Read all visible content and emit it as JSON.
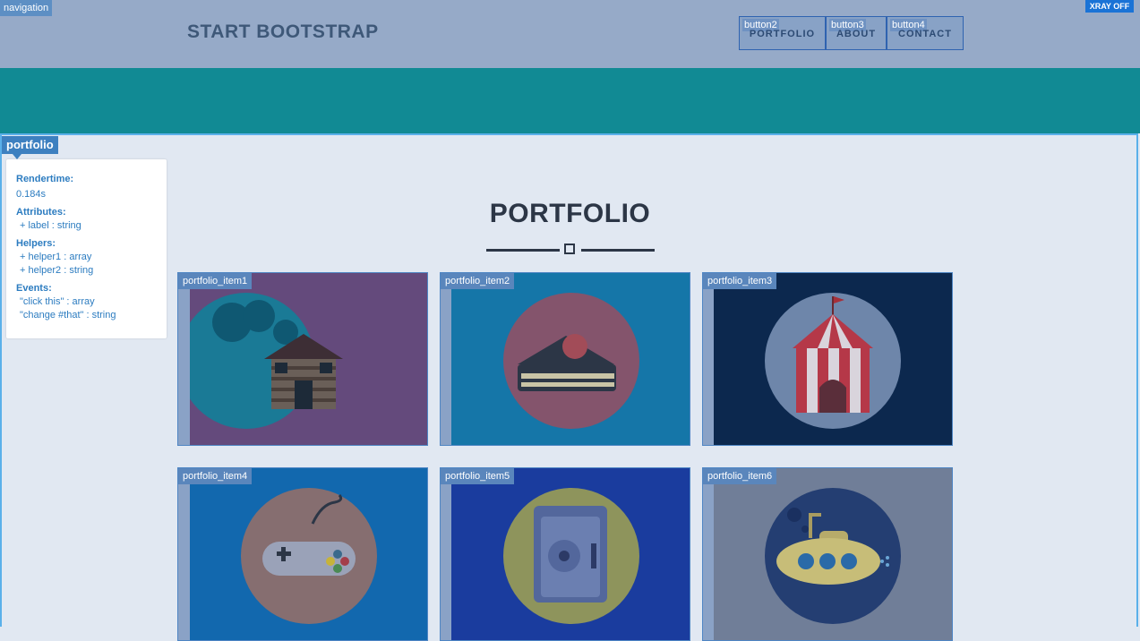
{
  "xray": {
    "navigation_tag": "navigation",
    "toggle_label": "XRAY OFF",
    "portfolio_tag": "portfolio"
  },
  "nav": {
    "brand": "START BOOTSTRAP",
    "buttons": [
      {
        "tag": "button2",
        "label": "PORTFOLIO"
      },
      {
        "tag": "button3",
        "label": "ABOUT"
      },
      {
        "tag": "button4",
        "label": "CONTACT"
      }
    ]
  },
  "inspector": {
    "rendertime_heading": "Rendertime:",
    "rendertime_value": "0.184s",
    "attributes_heading": "Attributes:",
    "attributes": [
      "+ label : string"
    ],
    "helpers_heading": "Helpers:",
    "helpers": [
      "+ helper1 : array",
      "+ helper2 : string"
    ],
    "events_heading": "Events:",
    "events": [
      "\"click this\" : array",
      "\"change #that\" : string"
    ]
  },
  "section": {
    "title": "PORTFOLIO"
  },
  "items": [
    {
      "tag": "portfolio_item1",
      "icon": "cabin-icon",
      "bg": "#644a7c",
      "circle": "#1a7a96"
    },
    {
      "tag": "portfolio_item2",
      "icon": "cake-icon",
      "bg": "#1576a8",
      "circle": "#84546c"
    },
    {
      "tag": "portfolio_item3",
      "icon": "circus-tent-icon",
      "bg": "#0c284e",
      "circle": "#6e86aa"
    },
    {
      "tag": "portfolio_item4",
      "icon": "game-controller-icon",
      "bg": "#1268ae",
      "circle": "#866e70"
    },
    {
      "tag": "portfolio_item5",
      "icon": "safe-icon",
      "bg": "#1a3c9e",
      "circle": "#8e945c"
    },
    {
      "tag": "portfolio_item6",
      "icon": "submarine-icon",
      "bg": "#707e98",
      "circle": "#243e72"
    }
  ]
}
